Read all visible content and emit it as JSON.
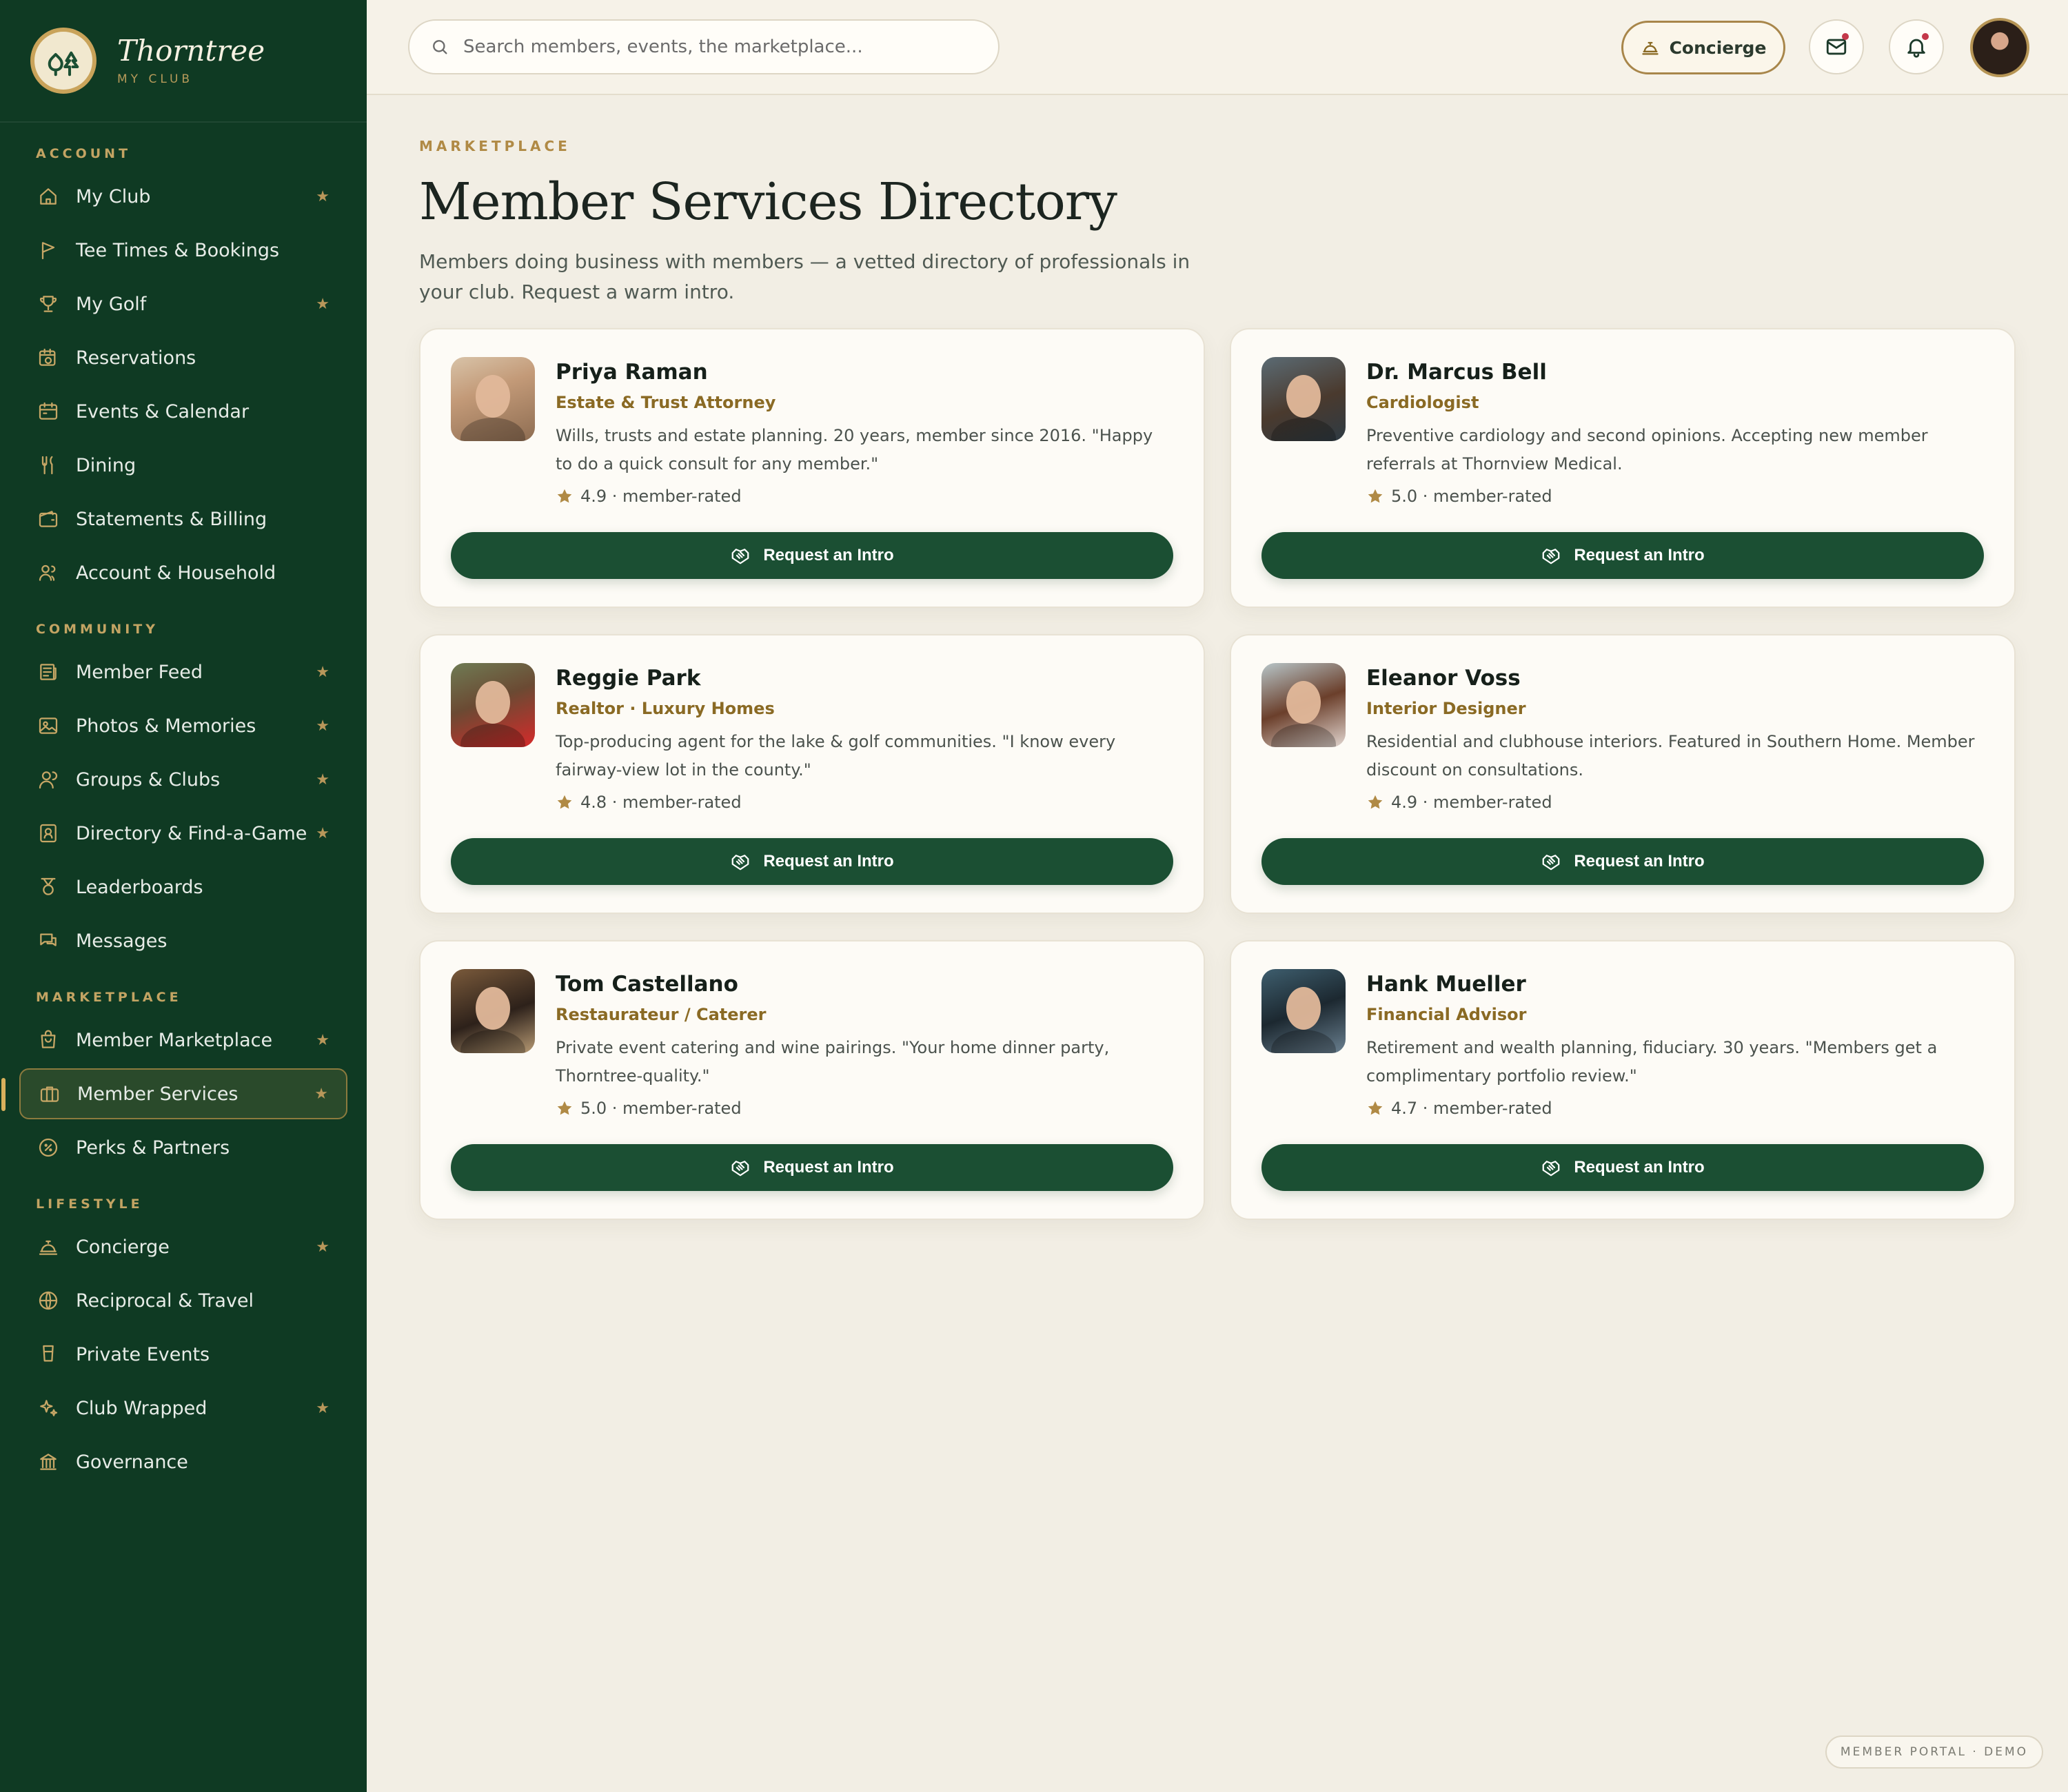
{
  "brand": {
    "name": "Thorntree",
    "sub": "MY CLUB"
  },
  "nav": {
    "sections": [
      {
        "heading": "ACCOUNT",
        "items": [
          {
            "label": "My Club",
            "icon": "home-icon",
            "star": true
          },
          {
            "label": "Tee Times & Bookings",
            "icon": "flag-icon",
            "star": false
          },
          {
            "label": "My Golf",
            "icon": "trophy-icon",
            "star": true
          },
          {
            "label": "Reservations",
            "icon": "calendar-clock-icon",
            "star": false
          },
          {
            "label": "Events & Calendar",
            "icon": "calendar-icon",
            "star": false
          },
          {
            "label": "Dining",
            "icon": "fork-knife-icon",
            "star": false
          },
          {
            "label": "Statements & Billing",
            "icon": "wallet-icon",
            "star": false
          },
          {
            "label": "Account & Household",
            "icon": "users-icon",
            "star": false
          }
        ]
      },
      {
        "heading": "COMMUNITY",
        "items": [
          {
            "label": "Member Feed",
            "icon": "newspaper-icon",
            "star": true
          },
          {
            "label": "Photos & Memories",
            "icon": "image-icon",
            "star": true
          },
          {
            "label": "Groups & Clubs",
            "icon": "user-group-icon",
            "star": true
          },
          {
            "label": "Directory & Find-a-Game",
            "icon": "id-card-icon",
            "star": true
          },
          {
            "label": "Leaderboards",
            "icon": "medal-icon",
            "star": false
          },
          {
            "label": "Messages",
            "icon": "chat-icon",
            "star": false
          }
        ]
      },
      {
        "heading": "MARKETPLACE",
        "items": [
          {
            "label": "Member Marketplace",
            "icon": "shopping-bag-icon",
            "star": true
          },
          {
            "label": "Member Services",
            "icon": "briefcase-icon",
            "star": true,
            "active": true
          },
          {
            "label": "Perks & Partners",
            "icon": "discount-icon",
            "star": false
          }
        ]
      },
      {
        "heading": "LIFESTYLE",
        "items": [
          {
            "label": "Concierge",
            "icon": "service-bell-icon",
            "star": true
          },
          {
            "label": "Reciprocal & Travel",
            "icon": "globe-icon",
            "star": false
          },
          {
            "label": "Private Events",
            "icon": "glass-icon",
            "star": false
          },
          {
            "label": "Club Wrapped",
            "icon": "sparkles-icon",
            "star": true
          },
          {
            "label": "Governance",
            "icon": "columns-icon",
            "star": false
          }
        ]
      }
    ],
    "star_glyph": "★"
  },
  "topbar": {
    "search_placeholder": "Search members, events, the marketplace...",
    "concierge_label": "Concierge"
  },
  "page": {
    "eyebrow": "MARKETPLACE",
    "title": "Member Services Directory",
    "subtitle": "Members doing business with members — a vetted directory of professionals in your club. Request a warm intro."
  },
  "cards": [
    {
      "name": "Priya Raman",
      "role": "Estate & Trust Attorney",
      "desc": "Wills, trusts and estate planning. 20 years, member since 2016. \"Happy to do a quick consult for any member.\"",
      "rating": "4.9 · member-rated",
      "button": "Request an Intro"
    },
    {
      "name": "Dr. Marcus Bell",
      "role": "Cardiologist",
      "desc": "Preventive cardiology and second opinions. Accepting new member referrals at Thornview Medical.",
      "rating": "5.0 · member-rated",
      "button": "Request an Intro"
    },
    {
      "name": "Reggie Park",
      "role": "Realtor · Luxury Homes",
      "desc": "Top-producing agent for the lake & golf communities. \"I know every fairway-view lot in the county.\"",
      "rating": "4.8 · member-rated",
      "button": "Request an Intro"
    },
    {
      "name": "Eleanor Voss",
      "role": "Interior Designer",
      "desc": "Residential and clubhouse interiors. Featured in Southern Home. Member discount on consultations.",
      "rating": "4.9 · member-rated",
      "button": "Request an Intro"
    },
    {
      "name": "Tom Castellano",
      "role": "Restaurateur / Caterer",
      "desc": "Private event catering and wine pairings. \"Your home dinner party, Thorntree-quality.\"",
      "rating": "5.0 · member-rated",
      "button": "Request an Intro"
    },
    {
      "name": "Hank Mueller",
      "role": "Financial Advisor",
      "desc": "Retirement and wealth planning, fiduciary. 30 years. \"Members get a complimentary portfolio review.\"",
      "rating": "4.7 · member-rated",
      "button": "Request an Intro"
    }
  ],
  "footer_badge": "MEMBER PORTAL · DEMO",
  "colors": {
    "sidebar_bg": "#0f3a23",
    "accent_gold": "#b08a45",
    "button_green": "#1b4f33",
    "page_bg": "#f2eee4"
  }
}
